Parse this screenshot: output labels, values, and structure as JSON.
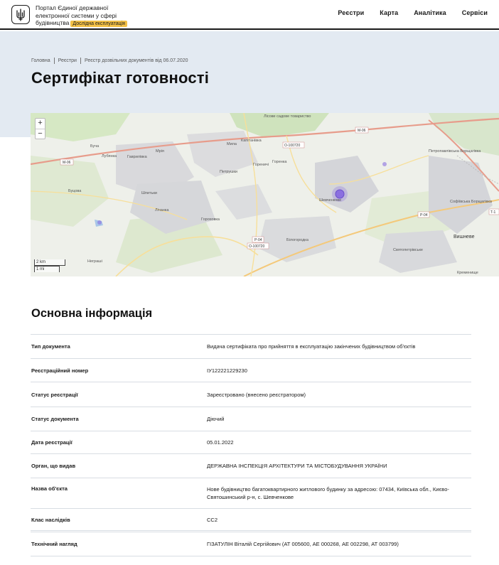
{
  "header": {
    "brand_lines": [
      "Портал Єдиної державної",
      "електронної системи у сфері",
      "будівництва"
    ],
    "badge": "Дослідна експлуатація",
    "nav": [
      "Реєстри",
      "Карта",
      "Аналітика",
      "Сервіси"
    ]
  },
  "breadcrumbs": [
    "Головна",
    "Реєстри",
    "Реєстр дозвільних документів від 06.07.2020"
  ],
  "page_title": "Сертифікат готовності",
  "map": {
    "zoom_in": "+",
    "zoom_out": "−",
    "scale_km": "2 km",
    "scale_mi": "1 mi",
    "labels": [
      "Буча",
      "Лубянка",
      "Гаврилівка",
      "Мрія",
      "Мила",
      "Капітанівка",
      "Горенка",
      "Гореничі",
      "Петрушки",
      "Шевченкове",
      "Шпитьки",
      "Лічанка",
      "Буцова",
      "Гороховка",
      "Білогородка",
      "Святопетрівське",
      "Вишневе",
      "Петропавлівська Борщагівка",
      "Софіївська Борщагівка",
      "Кременище",
      "Неграші",
      "Лісове садове товариство",
      "M-06",
      "O-100720",
      "P-04",
      "T-1"
    ],
    "road_colors": {
      "primary": "#e79c8b",
      "secondary": "#f4c97a",
      "tertiary": "#f7df9a"
    },
    "marker_color": "#8b6fe0"
  },
  "info": {
    "section_title": "Основна інформація",
    "rows": [
      {
        "key": "Тип документа",
        "value": "Видача сертифіката про прийняття в експлуатацію закінчених будівництвом об'єктів"
      },
      {
        "key": "Реєстраційний номер",
        "value": "ІУ122221229230"
      },
      {
        "key": "Статус реєстрації",
        "value": "Зареєстровано (внесено реєстратором)"
      },
      {
        "key": "Статус документа",
        "value": "Діючий"
      },
      {
        "key": "Дата реєстрації",
        "value": "05.01.2022"
      },
      {
        "key": "Орган, що видав",
        "value": "ДЕРЖАВНА ІНСПЕКЦІЯ АРХІТЕКТУРИ ТА МІСТОБУДУВАННЯ УКРАЇНИ"
      },
      {
        "key": "Назва об'єкта",
        "value": "Нове будівництво багатоквартирного житлового будинку за адресою: 07434, Київська обл., Києво-Святошинський р-н, с. Шевченкове"
      },
      {
        "key": "Клас наслідків",
        "value": "СС2"
      },
      {
        "key": "Технічний нагляд",
        "value": "ГІЗАТУЛІН Віталій Сергійович (АТ 005600, АЕ 000268, АЕ 002298, АТ 003799)"
      }
    ]
  }
}
